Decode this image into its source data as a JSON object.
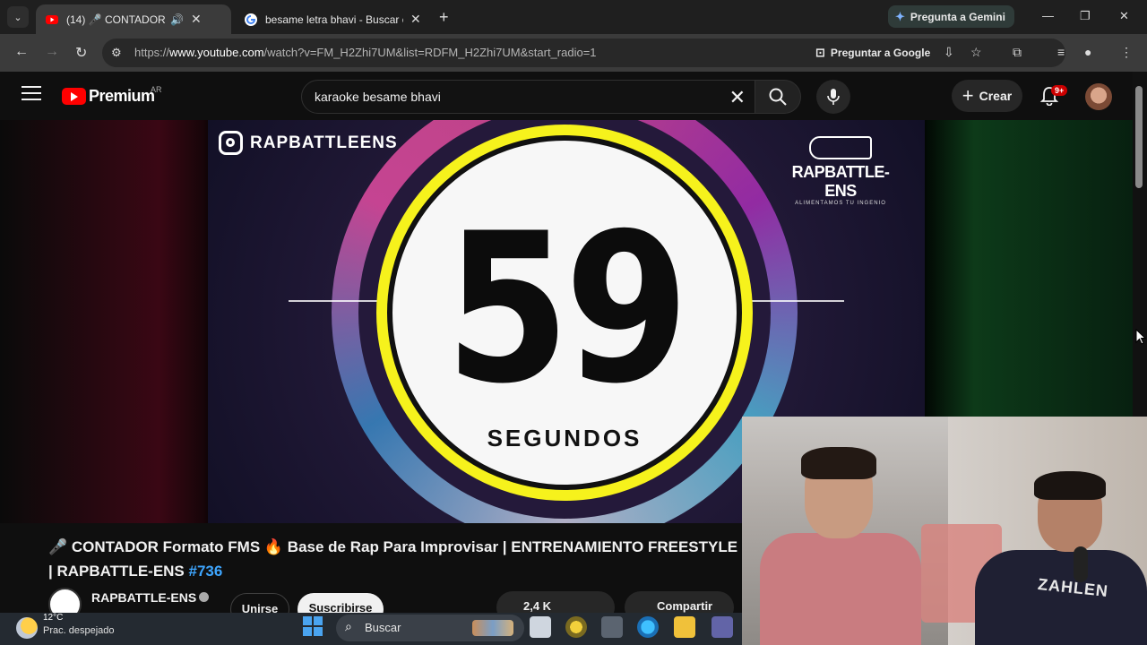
{
  "browser": {
    "tabs": [
      {
        "title": "(14) 🎤 CONTADOR Formato FMS",
        "active": true
      },
      {
        "title": "besame letra bhavi - Buscar con Google",
        "active": false
      }
    ],
    "gemini_button": "Pregunta a Gemini",
    "url_prefix": "https://",
    "url_domain": "www.youtube.com",
    "url_path": "/watch?v=FM_H2Zhi7UM&list=RDFM_H2Zhi7UM&start_radio=1",
    "ask_google": "Preguntar a Google"
  },
  "youtube": {
    "logo_text": "Premium",
    "country": "AR",
    "search_query": "karaoke besame bhavi",
    "create_label": "Crear",
    "notifications_badge": "9+"
  },
  "video": {
    "instagram_handle": "RAPBATTLEENS",
    "brand_name": "RAPBATTLE-ENS",
    "brand_tagline": "ALIMENTAMOS TU INGENIO",
    "countdown": "59",
    "countdown_label": "SEGUNDOS"
  },
  "info": {
    "title_line": "🎤 CONTADOR Formato FMS 🔥 Base de Rap Para Improvisar | ENTRENAMIENTO FREESTYLE | RAPBATTLE-ENS",
    "hashtag": "#736",
    "channel_name": "RAPBATTLE-ENS",
    "join_label": "Unirse",
    "subscribe_label": "Suscribirse",
    "like_count": "2,4 K",
    "share_label": "Compartir"
  },
  "webcam": {
    "shirt_text": "ZAHLEN"
  },
  "taskbar": {
    "temperature": "12°C",
    "weather": "Prac. despejado",
    "search_label": "Buscar"
  }
}
